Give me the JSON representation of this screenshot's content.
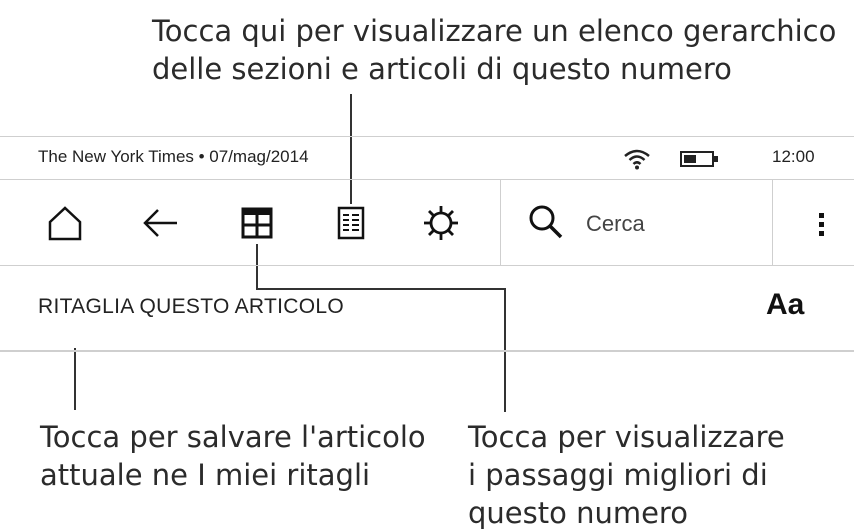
{
  "callouts": {
    "top": [
      "Tocca qui per visualizzare un elenco gerarchico",
      "delle sezioni e articoli di questo numero"
    ],
    "left": [
      "Tocca per salvare l'articolo",
      "attuale ne I miei ritagli"
    ],
    "right": [
      "Tocca per visualizzare",
      "i passaggi migliori di",
      "questo numero"
    ]
  },
  "status_bar": {
    "title": "The New York Times • 07/mag/2014",
    "clock": "12:00",
    "icons": [
      "wifi-icon",
      "battery-icon"
    ]
  },
  "toolbar": {
    "icons": [
      "home-icon",
      "back-arrow-icon",
      "sections-grid-icon",
      "article-list-icon",
      "settings-gear-icon",
      "search-icon",
      "more-vertical-icon"
    ],
    "search_label": "Cerca"
  },
  "clip_bar": {
    "clip_label": "RITAGLIA QUESTO ARTICOLO",
    "font_label": "Aa"
  }
}
